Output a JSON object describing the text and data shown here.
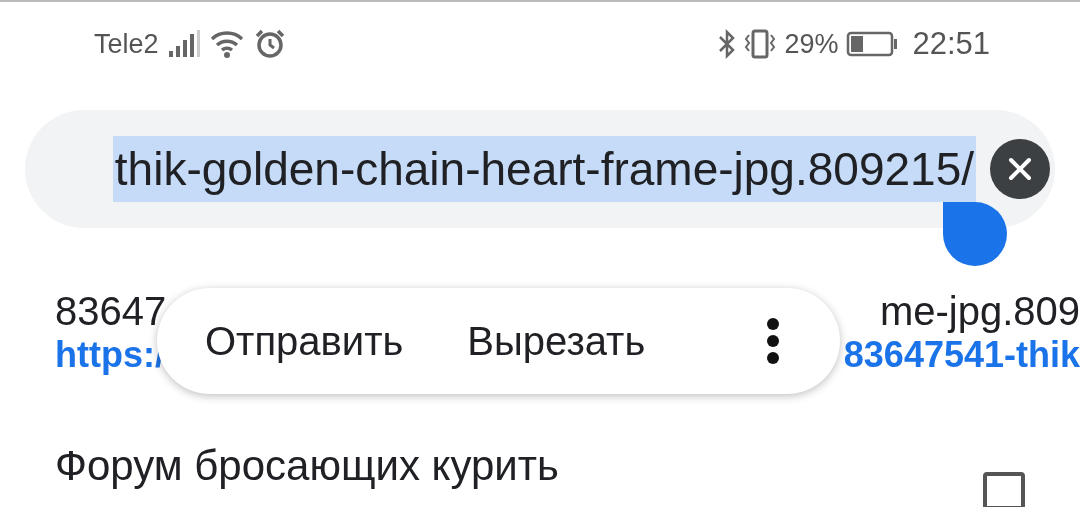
{
  "status_bar": {
    "carrier": "Tele2",
    "battery_percent": "29%",
    "time": "22:51"
  },
  "address_bar": {
    "value": "thik-golden-chain-heart-frame-jpg.809215/",
    "text_selected": true
  },
  "suggestion": {
    "title_start": "83647",
    "title_end": "me-jpg.809",
    "url_start": "https:/",
    "url_end": "83647541-thik"
  },
  "context_menu": {
    "items": [
      {
        "label": "Отправить"
      },
      {
        "label": "Вырезать"
      }
    ]
  },
  "next_suggestion": {
    "title": "Форум бросающих курить"
  }
}
